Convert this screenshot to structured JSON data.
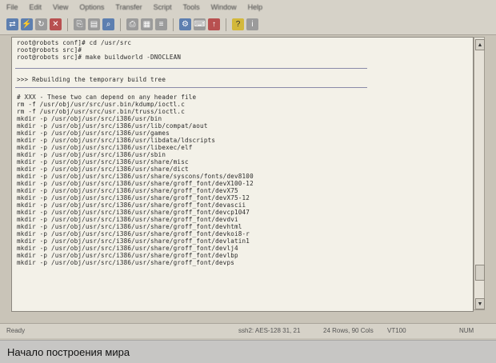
{
  "menu": [
    "File",
    "Edit",
    "View",
    "Options",
    "Transfer",
    "Script",
    "Tools",
    "Window",
    "Help"
  ],
  "terminal": {
    "prompt_lines": [
      "root@robots conf]# cd /usr/src",
      "root@robots src]#",
      "root@robots src]# make buildworld -DNOCLEAN"
    ],
    "section_header": ">>> Rebuilding the temporary build tree",
    "output_lines": [
      "# XXX - These two can depend on any header file",
      "rm -f /usr/obj/usr/src/usr.bin/kdump/ioctl.c",
      "rm -f /usr/obj/usr/src/usr.bin/truss/ioctl.c",
      "mkdir -p /usr/obj/usr/src/i386/usr/bin",
      "mkdir -p /usr/obj/usr/src/i386/usr/lib/compat/aout",
      "mkdir -p /usr/obj/usr/src/i386/usr/games",
      "mkdir -p /usr/obj/usr/src/i386/usr/libdata/ldscripts",
      "mkdir -p /usr/obj/usr/src/i386/usr/libexec/elf",
      "mkdir -p /usr/obj/usr/src/i386/usr/sbin",
      "mkdir -p /usr/obj/usr/src/i386/usr/share/misc",
      "mkdir -p /usr/obj/usr/src/i386/usr/share/dict",
      "mkdir -p /usr/obj/usr/src/i386/usr/share/syscons/fonts/dev8100",
      "mkdir -p /usr/obj/usr/src/i386/usr/share/groff_font/devX100-12",
      "mkdir -p /usr/obj/usr/src/i386/usr/share/groff_font/devX75",
      "mkdir -p /usr/obj/usr/src/i386/usr/share/groff_font/devX75-12",
      "mkdir -p /usr/obj/usr/src/i386/usr/share/groff_font/devascii",
      "mkdir -p /usr/obj/usr/src/i386/usr/share/groff_font/devcp1047",
      "mkdir -p /usr/obj/usr/src/i386/usr/share/groff_font/devdvi",
      "mkdir -p /usr/obj/usr/src/i386/usr/share/groff_font/devhtml",
      "mkdir -p /usr/obj/usr/src/i386/usr/share/groff_font/devkoi8-r",
      "mkdir -p /usr/obj/usr/src/i386/usr/share/groff_font/devlatin1",
      "mkdir -p /usr/obj/usr/src/i386/usr/share/groff_font/devlj4",
      "mkdir -p /usr/obj/usr/src/i386/usr/share/groff_font/devlbp",
      "mkdir -p /usr/obj/usr/src/i386/usr/share/groff_font/devps"
    ]
  },
  "status": {
    "left": "Ready",
    "ssh": "ssh2: AES-128  31, 21",
    "size": "24 Rows, 90 Cols",
    "term": "VT100",
    "num": "NUM"
  },
  "caption": "Начало построения мира"
}
